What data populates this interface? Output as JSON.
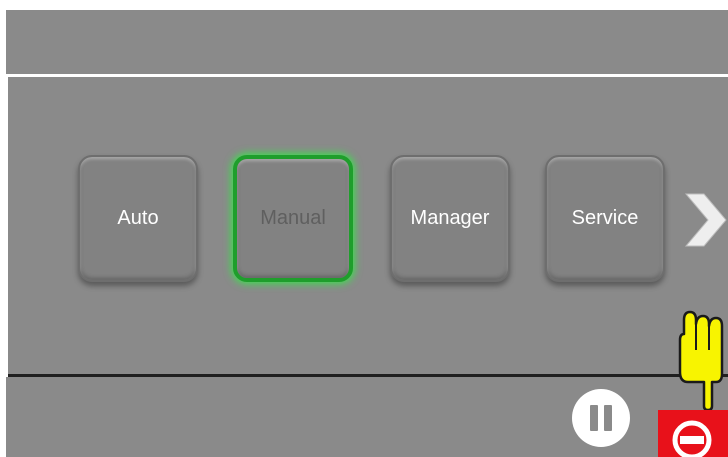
{
  "modes": {
    "auto": "Auto",
    "manual": "Manual",
    "manager": "Manager",
    "service": "Service",
    "active": "manual"
  },
  "colors": {
    "panel": "#8a8a8a",
    "active_border": "#1f9e2c",
    "stop_red": "#e8111a",
    "hand_yellow": "#f8f400"
  },
  "icons": {
    "next": "chevron-right-icon",
    "pause": "pause-icon",
    "stop": "no-entry-icon",
    "pointer": "pointing-hand-icon"
  }
}
